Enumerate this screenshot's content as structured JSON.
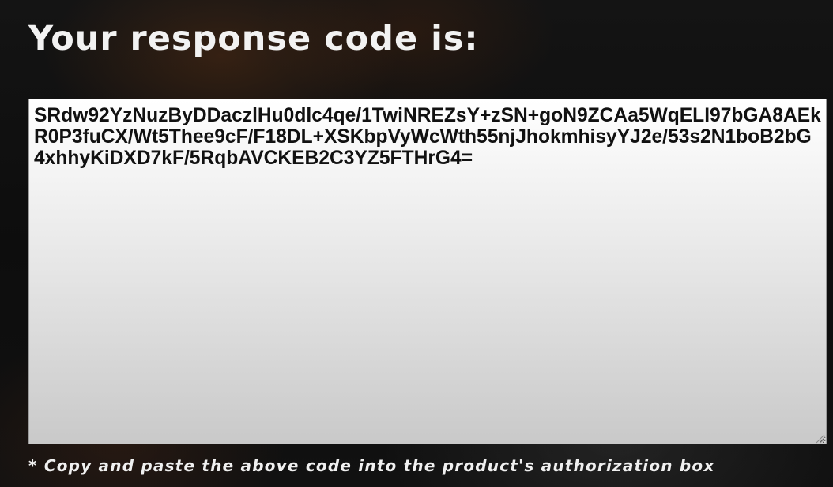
{
  "heading": {
    "title": "Your response code is:"
  },
  "response_code": {
    "value": "SRdw92YzNuzByDDaczlHu0dlc4qe/1TwiNREZsY+zSN+goN9ZCAa5WqELI97bGA8AEkR0P3fuCX/Wt5Thee9cF/F18DL+XSKbpVyWcWth55njJhokmhisyYJ2e/53s2N1boB2bG4xhhyKiDXD7kF/5RqbAVCKEB2C3YZ5FTHrG4="
  },
  "footer": {
    "note": "* Copy and paste the above code into the product's authorization box"
  },
  "colors": {
    "background": "#0d0d0d",
    "title_text": "#f2f2f2",
    "box_top": "#ffffff",
    "box_bottom": "#c9c9c9",
    "code_text": "#111111"
  },
  "icons": {
    "resize_grip": "resize-grip-icon"
  }
}
